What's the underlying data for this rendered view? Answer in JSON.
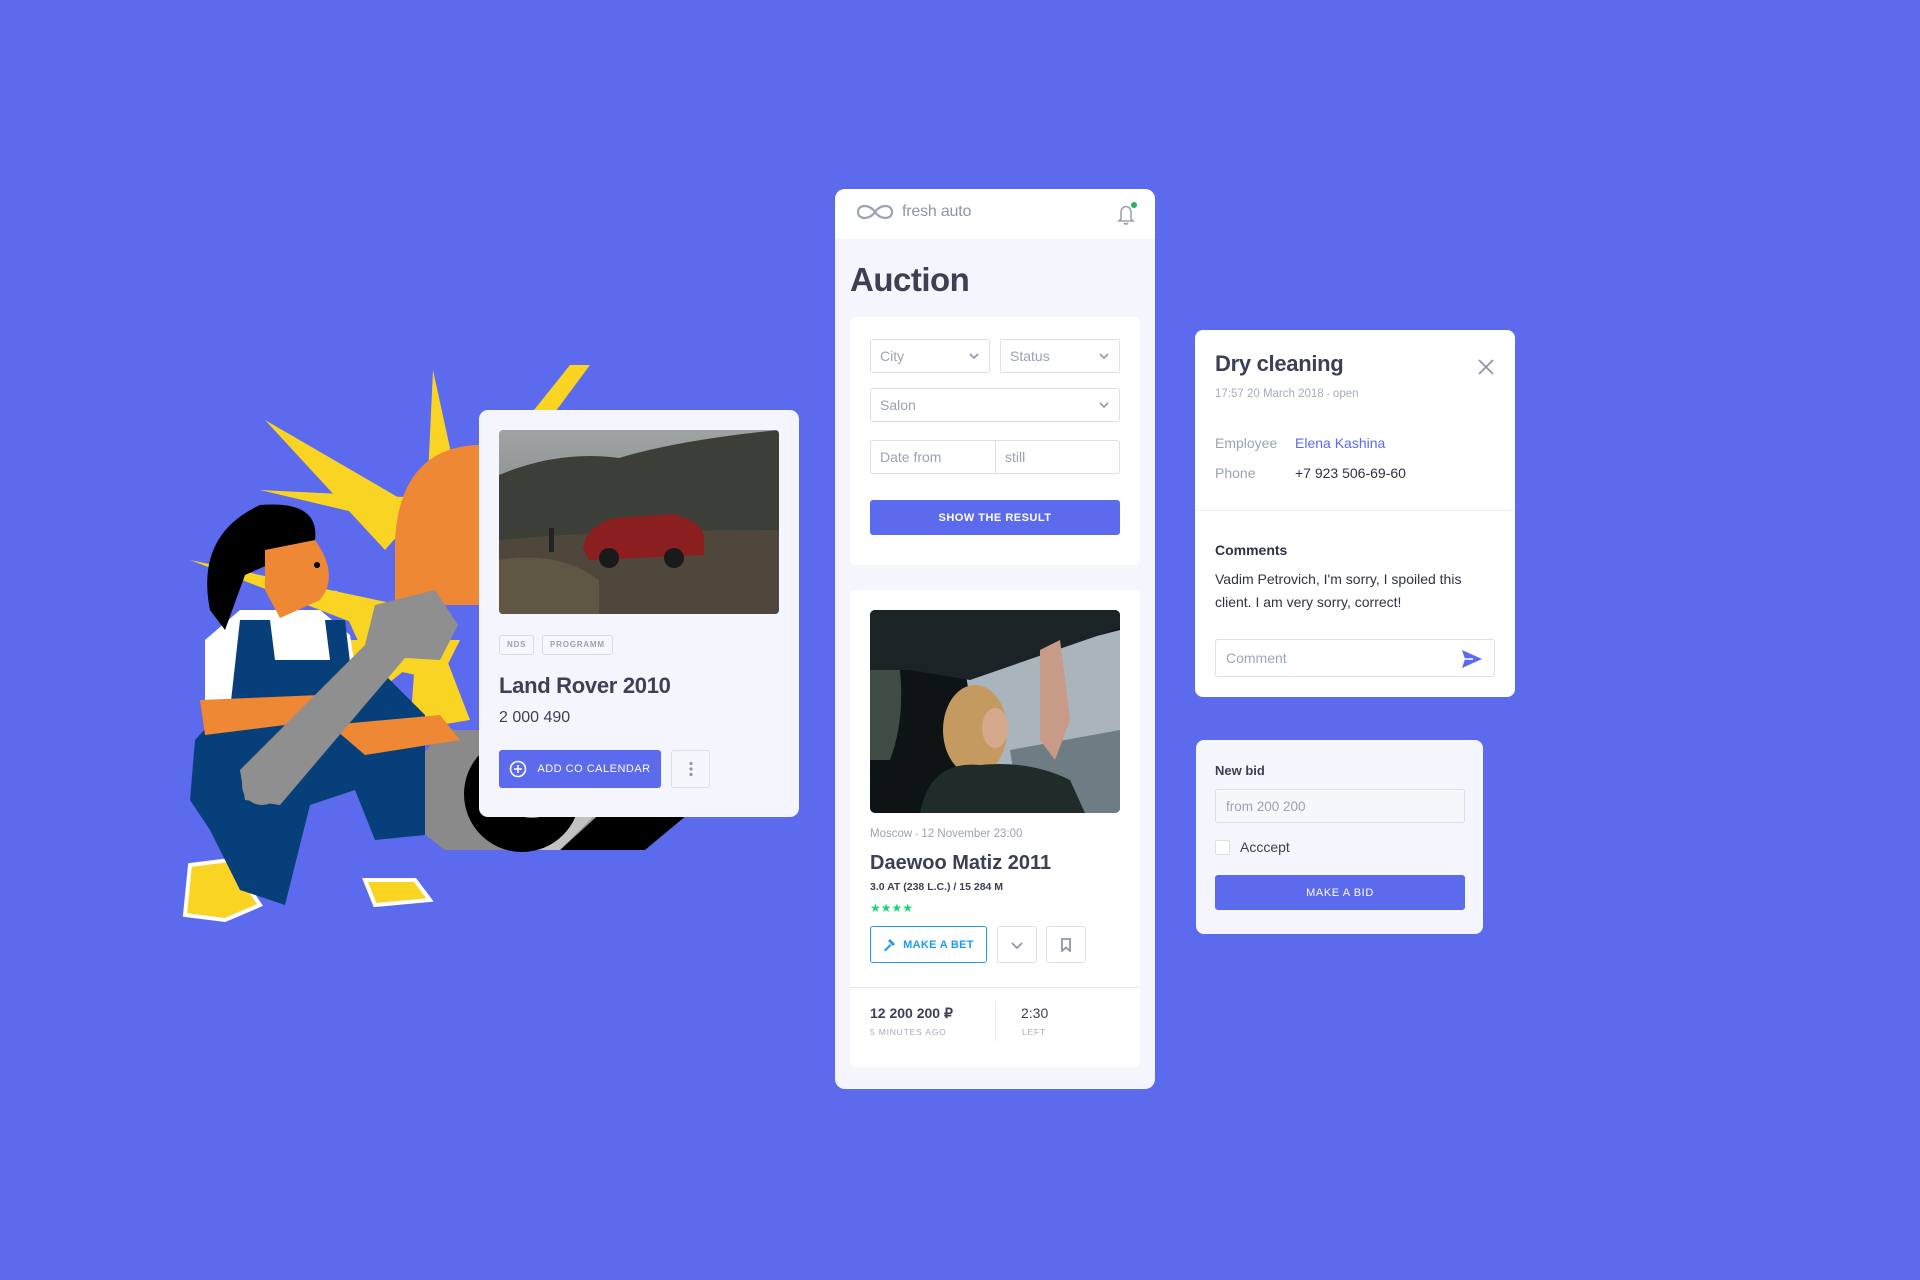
{
  "colors": {
    "background": "#5C6AEE",
    "accent": "#5C6AEE",
    "link": "#5C6AEE",
    "bet_button": "#1E9BF0",
    "stars": "#1ED37A",
    "notification_dot": "#26B35C"
  },
  "lot_card": {
    "photo": "red-suv-in-mountains-photo",
    "tags": [
      "NDS",
      "PROGRAMM"
    ],
    "title": "Land Rover 2010",
    "price": "2 000 490",
    "calendar_button": "ADD CO CALENDAR",
    "calendar_icon": "plus-circle-icon",
    "more_icon": "more-vertical-icon"
  },
  "app": {
    "brand": "fresh auto",
    "logo_icon": "infinity-icon",
    "bell_icon": "bell-icon",
    "has_notification": true,
    "page_title": "Auction",
    "filters": {
      "city_placeholder": "City",
      "status_placeholder": "Status",
      "salon_placeholder": "Salon",
      "date_from_placeholder": "Date from",
      "date_to_placeholder": "still",
      "submit_label": "SHOW THE RESULT"
    },
    "result": {
      "photo": "woman-in-car-photo",
      "city": "Moscow",
      "separator": "•",
      "date": "12 November 23:00",
      "title": "Daewoo Matiz 2011",
      "specs": "3.0 AT (238 L.C.) / 15 284 M",
      "rating": 4,
      "rating_max": 4,
      "stars": "★★★★",
      "bet_button": "MAKE A BET",
      "bet_icon": "gavel-icon",
      "expand_icon": "chevron-down-icon",
      "bookmark_icon": "bookmark-icon",
      "current_bid": "12 200 200 ₽",
      "current_bid_sub": "5 MINUTES AGO",
      "time_left": "2:30",
      "time_left_sub": "LEFT"
    }
  },
  "task": {
    "title": "Dry cleaning",
    "time": "17:57 20 March 2018",
    "separator": "•",
    "status": "open",
    "close_icon": "close-icon",
    "employee_label": "Employee",
    "employee_value": "Elena Kashina",
    "phone_label": "Phone",
    "phone_value": "+7 923 506-69-60",
    "comments_label": "Comments",
    "comment_text": "Vadim Petrovich, I'm sorry, I spoiled this client. I am very sorry, correct!",
    "comment_placeholder": "Comment",
    "send_icon": "send-icon"
  },
  "bid": {
    "label": "New bid",
    "input_placeholder": "from 200 200",
    "checkbox_label": "Acccept",
    "checked": false,
    "submit_label": "MAKE A BID"
  }
}
